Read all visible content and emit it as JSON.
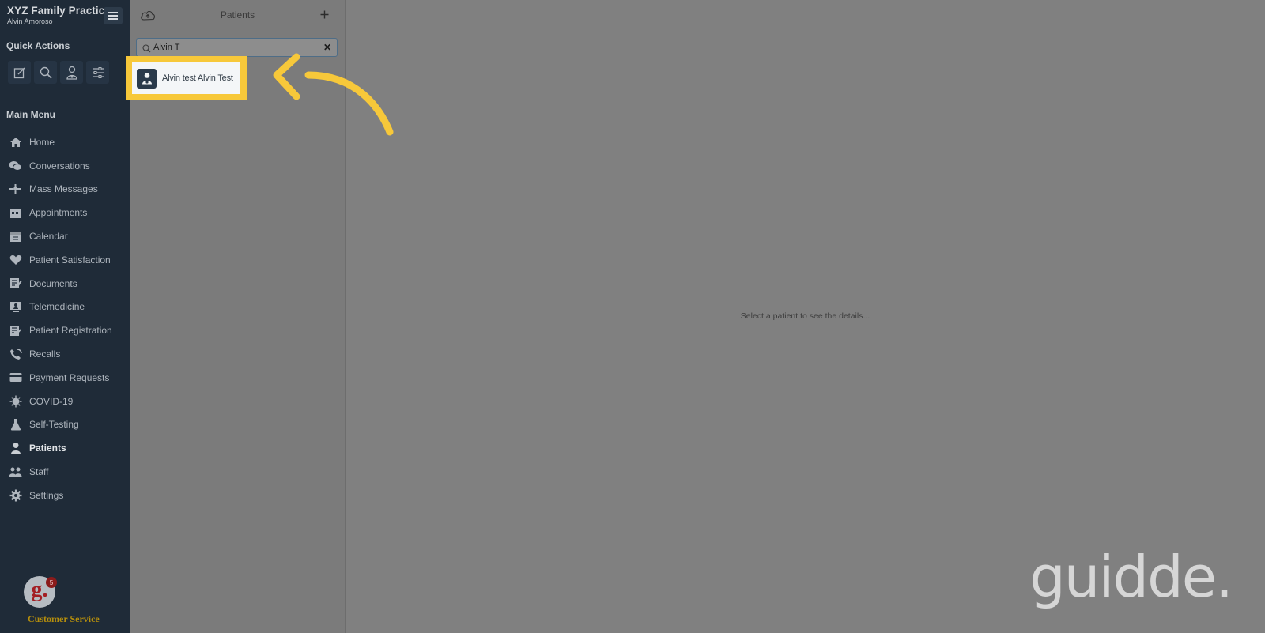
{
  "sidebar": {
    "practice_name": "XYZ Family Practice",
    "user_name": "Alvin Amoroso",
    "quick_actions_title": "Quick Actions",
    "quick_actions": [
      {
        "icon": "compose-icon"
      },
      {
        "icon": "search-icon"
      },
      {
        "icon": "patient-add-icon"
      },
      {
        "icon": "sliders-icon"
      }
    ],
    "main_menu_title": "Main Menu",
    "items": [
      {
        "label": "Home",
        "icon": "home-icon"
      },
      {
        "label": "Conversations",
        "icon": "chat-icon"
      },
      {
        "label": "Mass Messages",
        "icon": "broadcast-icon"
      },
      {
        "label": "Appointments",
        "icon": "appointments-icon"
      },
      {
        "label": "Calendar",
        "icon": "calendar-icon"
      },
      {
        "label": "Patient Satisfaction",
        "icon": "heart-icon"
      },
      {
        "label": "Documents",
        "icon": "documents-icon"
      },
      {
        "label": "Telemedicine",
        "icon": "telemedicine-icon"
      },
      {
        "label": "Patient Registration",
        "icon": "registration-icon"
      },
      {
        "label": "Recalls",
        "icon": "phone-icon"
      },
      {
        "label": "Payment Requests",
        "icon": "credit-card-icon"
      },
      {
        "label": "COVID-19",
        "icon": "virus-icon"
      },
      {
        "label": "Self-Testing",
        "icon": "flask-icon"
      },
      {
        "label": "Patients",
        "icon": "patient-icon"
      },
      {
        "label": "Staff",
        "icon": "staff-icon"
      },
      {
        "label": "Settings",
        "icon": "gear-icon"
      }
    ],
    "active_item": "Patients",
    "customer_service": {
      "label": "Customer Service",
      "badge_count": "5",
      "logo_letter": "g."
    }
  },
  "patients": {
    "title": "Patients",
    "search_value": "Alvin T",
    "results": [
      {
        "name": "Alvin test Alvin Test"
      }
    ]
  },
  "details": {
    "placeholder": "Select a patient to see the details..."
  },
  "watermark": "guidde.",
  "colors": {
    "sidebar_bg": "#1f2b38",
    "highlight": "#f7c83a",
    "overlay_gray": "#808080",
    "customer_service": "#b58e0c"
  }
}
